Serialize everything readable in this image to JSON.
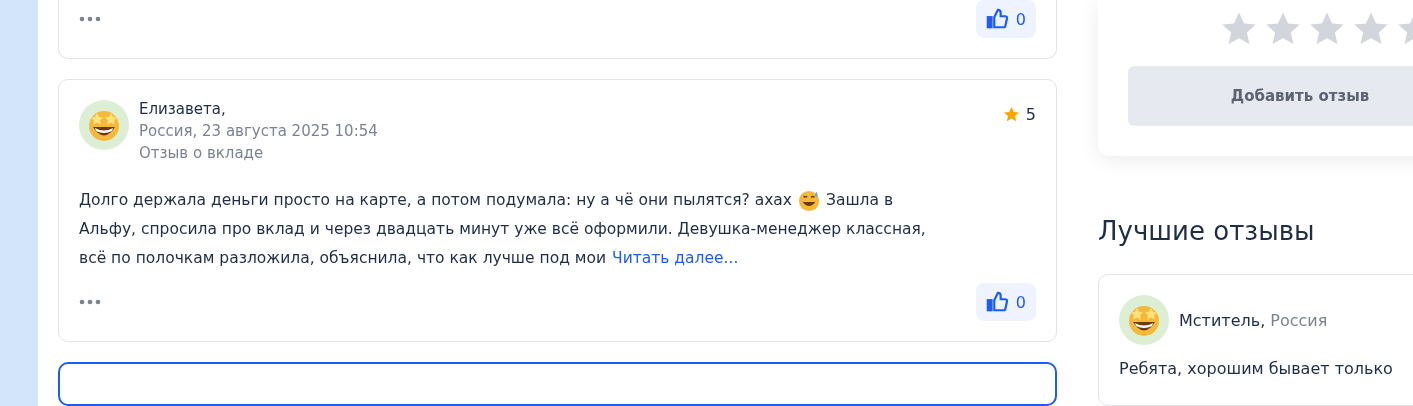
{
  "reviews": [
    {
      "kind": "tail",
      "highlighted": false,
      "likes": "0"
    },
    {
      "kind": "full",
      "highlighted": false,
      "author": "Елизавета,",
      "meta": "Россия, 23 августа 2025 10:54",
      "topic": "Отзыв о вкладе",
      "rating": "5",
      "text_before": "Долго держала деньги просто на карте, а потом подумала: ну а чё они пылятся? ахах",
      "text_after": "Зашла в",
      "line_2": "Альфу, спросила про вклад и через двадцать минут уже всё оформили. Девушка-менеджер классная,",
      "line_3": "всё по полочкам разложила, объяснила, что как лучше под мои",
      "read_more": "Читать далее...",
      "likes": "0"
    },
    {
      "kind": "head",
      "highlighted": true
    }
  ],
  "rate_panel": {
    "stars": 0,
    "button": "Добавить отзыв"
  },
  "best": {
    "title": "Лучшие отзывы",
    "items": [
      {
        "author": "Мститель,",
        "country": "Россия",
        "text": "Ребята, хорошим бывает только"
      }
    ]
  }
}
